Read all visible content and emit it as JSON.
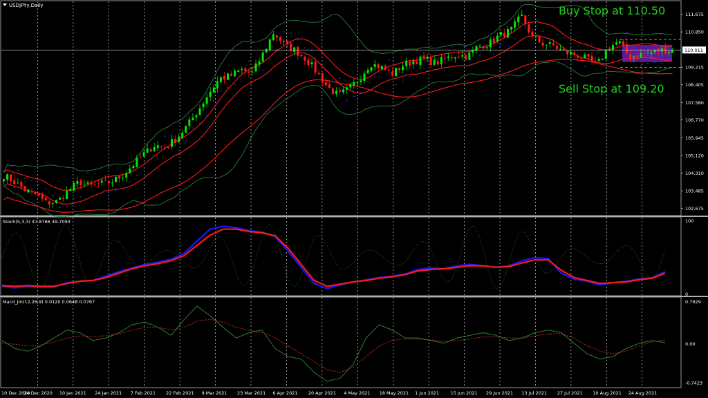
{
  "header": {
    "symbol_title": "USDJPYy,Daily"
  },
  "annotations": {
    "buy_stop": "Buy Stop at 110.50",
    "sell_stop": "Sell Stop at 109.20"
  },
  "colors": {
    "background": "#000000",
    "bull": "#00e600",
    "bear": "#ff1a1a",
    "envelope": "#ff1a1a",
    "bollinger": "#2e7d3a",
    "psar": "#2a4cff",
    "stoch_main": "#1a1aff",
    "stoch_signal": "#ff1a1a",
    "stoch_raw": "#1f7a1f",
    "macd_main": "#2e7d2e",
    "macd_signal": "#c83030",
    "consolidation_box": "#6a1fb0"
  },
  "chart_data": [
    {
      "type": "candlestick",
      "title": "USDJPYy,Daily",
      "price_labels": [
        "111.675",
        "110.850",
        "110.011",
        "109.215",
        "108.405",
        "107.580",
        "106.770",
        "105.945",
        "105.120",
        "104.310",
        "103.485",
        "102.675"
      ],
      "current_price": "110.011",
      "ylim": [
        102.4,
        112.2
      ],
      "buy_stop": 110.5,
      "sell_stop": 109.2,
      "consolidation_range": [
        109.45,
        110.25
      ],
      "date_labels": [
        "10 Dec 2020",
        "24 Dec 2020",
        "10 Jan 2021",
        "24 Jan 2021",
        "7 Feb 2021",
        "22 Feb 2021",
        "9 Mar 2021",
        "23 Mar 2021",
        "6 Apr 2021",
        "20 Apr 2021",
        "4 May 2021",
        "18 May 2021",
        "1 Jun 2021",
        "15 Jun 2021",
        "29 Jun 2021",
        "13 Jul 2021",
        "27 Jul 2021",
        "10 Aug 2021",
        "24 Aug 2021"
      ],
      "close_anchors": [
        104.2,
        103.9,
        103.5,
        103.3,
        102.9,
        103.0,
        103.5,
        103.9,
        103.7,
        103.8,
        103.9,
        104.2,
        104.7,
        105.2,
        105.6,
        105.5,
        105.9,
        106.5,
        107.2,
        108.0,
        108.7,
        108.8,
        109.1,
        108.9,
        109.8,
        110.8,
        110.3,
        110.0,
        109.6,
        109.0,
        108.3,
        107.9,
        108.2,
        108.7,
        109.4,
        109.2,
        108.9,
        109.3,
        109.5,
        109.6,
        109.4,
        109.6,
        109.8,
        109.7,
        110.2,
        110.3,
        110.7,
        110.9,
        111.6,
        110.6,
        110.3,
        110.2,
        109.9,
        109.8,
        109.6,
        109.3,
        110.1,
        110.4,
        109.7,
        109.8,
        109.9,
        110.0,
        110.0
      ]
    },
    {
      "type": "line",
      "title": "Stoch(5,3,3) 47.8766 49.7093",
      "scale_labels": [
        "100",
        "0"
      ],
      "ylim": [
        0,
        100
      ],
      "series": [
        {
          "values": [
            10,
            8,
            10,
            9,
            9,
            15,
            17,
            18,
            24,
            30,
            35,
            40,
            43,
            47,
            55,
            72,
            88,
            92,
            90,
            86,
            84,
            78,
            58,
            36,
            14,
            7,
            12,
            16,
            19,
            22,
            24,
            27,
            33,
            35,
            34,
            38,
            40,
            38,
            36,
            38,
            45,
            49,
            48,
            28,
            20,
            17,
            12,
            15,
            17,
            20,
            22,
            30
          ]
        },
        {
          "values": [
            11,
            10,
            11,
            10,
            10,
            14,
            17,
            18,
            22,
            28,
            34,
            38,
            41,
            45,
            52,
            66,
            80,
            88,
            88,
            85,
            83,
            79,
            62,
            40,
            18,
            10,
            13,
            16,
            18,
            21,
            23,
            26,
            31,
            33,
            34,
            36,
            38,
            38,
            36,
            37,
            42,
            46,
            46,
            32,
            22,
            18,
            14,
            15,
            16,
            19,
            21,
            28
          ]
        }
      ]
    },
    {
      "type": "line",
      "title": "Macd_Jm(12,26,9) 0.0120 0.0648 0.0767",
      "scale_labels": [
        "0.7929",
        "0.00",
        "-0.7423"
      ],
      "ylim": [
        -0.8,
        0.82
      ],
      "series": [
        {
          "values": [
            0.05,
            -0.1,
            -0.15,
            -0.05,
            0.1,
            0.25,
            0.2,
            0.05,
            0.1,
            0.2,
            0.35,
            0.4,
            0.3,
            0.15,
            0.45,
            0.7,
            0.52,
            0.3,
            0.1,
            0.2,
            0.25,
            -0.1,
            -0.25,
            -0.3,
            -0.55,
            -0.72,
            -0.66,
            -0.4,
            0.1,
            0.35,
            0.25,
            0.1,
            0.1,
            0.05,
            0.0,
            0.1,
            0.15,
            0.2,
            0.15,
            0.05,
            0.1,
            0.2,
            0.25,
            0.2,
            0.0,
            -0.2,
            -0.3,
            -0.25,
            -0.1,
            0.0,
            0.05,
            0.01
          ]
        },
        {
          "values": [
            0.0,
            -0.02,
            -0.05,
            -0.03,
            0.02,
            0.1,
            0.14,
            0.13,
            0.14,
            0.18,
            0.25,
            0.3,
            0.3,
            0.25,
            0.3,
            0.42,
            0.45,
            0.4,
            0.3,
            0.25,
            0.2,
            0.1,
            -0.05,
            -0.2,
            -0.35,
            -0.5,
            -0.55,
            -0.45,
            -0.25,
            -0.05,
            0.05,
            0.08,
            0.08,
            0.06,
            0.04,
            0.05,
            0.08,
            0.12,
            0.12,
            0.1,
            0.1,
            0.14,
            0.18,
            0.18,
            0.1,
            -0.05,
            -0.15,
            -0.2,
            -0.15,
            -0.05,
            0.03,
            0.06
          ]
        }
      ]
    }
  ]
}
